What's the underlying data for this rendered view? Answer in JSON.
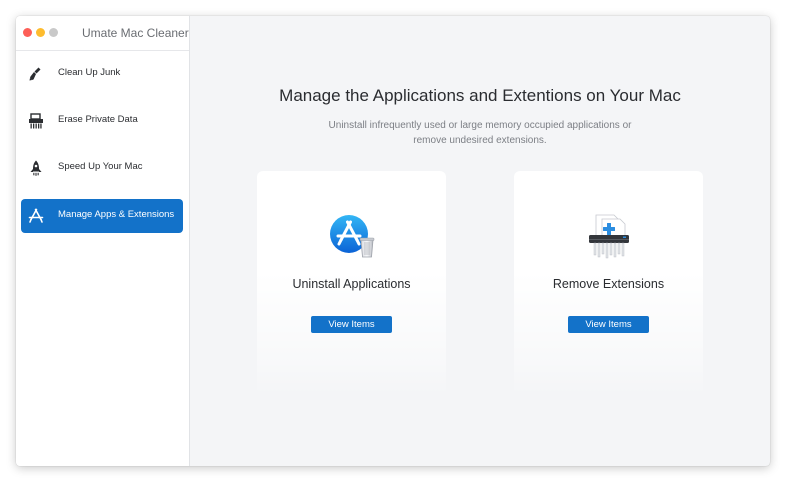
{
  "window": {
    "title": "Umate Mac Cleaner"
  },
  "sidebar": {
    "items": [
      {
        "label": "Clean Up Junk",
        "icon": "broom-icon",
        "active": false
      },
      {
        "label": "Erase Private Data",
        "icon": "shredder-icon",
        "active": false
      },
      {
        "label": "Speed Up Your Mac",
        "icon": "rocket-icon",
        "active": false
      },
      {
        "label": "Manage Apps & Extensions",
        "icon": "app-store-icon",
        "active": true
      }
    ]
  },
  "main": {
    "headline": "Manage the Applications and Extentions on Your Mac",
    "subline_1": "Uninstall infrequently used or large memory occupied applications or",
    "subline_2": "remove undesired extensions.",
    "cards": [
      {
        "title": "Uninstall Applications",
        "button_label": "View Items",
        "icon": "app-store-uninstall-icon"
      },
      {
        "title": "Remove Extensions",
        "button_label": "View Items",
        "icon": "extension-shredder-icon"
      }
    ]
  },
  "colors": {
    "accent": "#1372c9",
    "background": "#f4f5f7",
    "sidebar": "#ffffff"
  }
}
